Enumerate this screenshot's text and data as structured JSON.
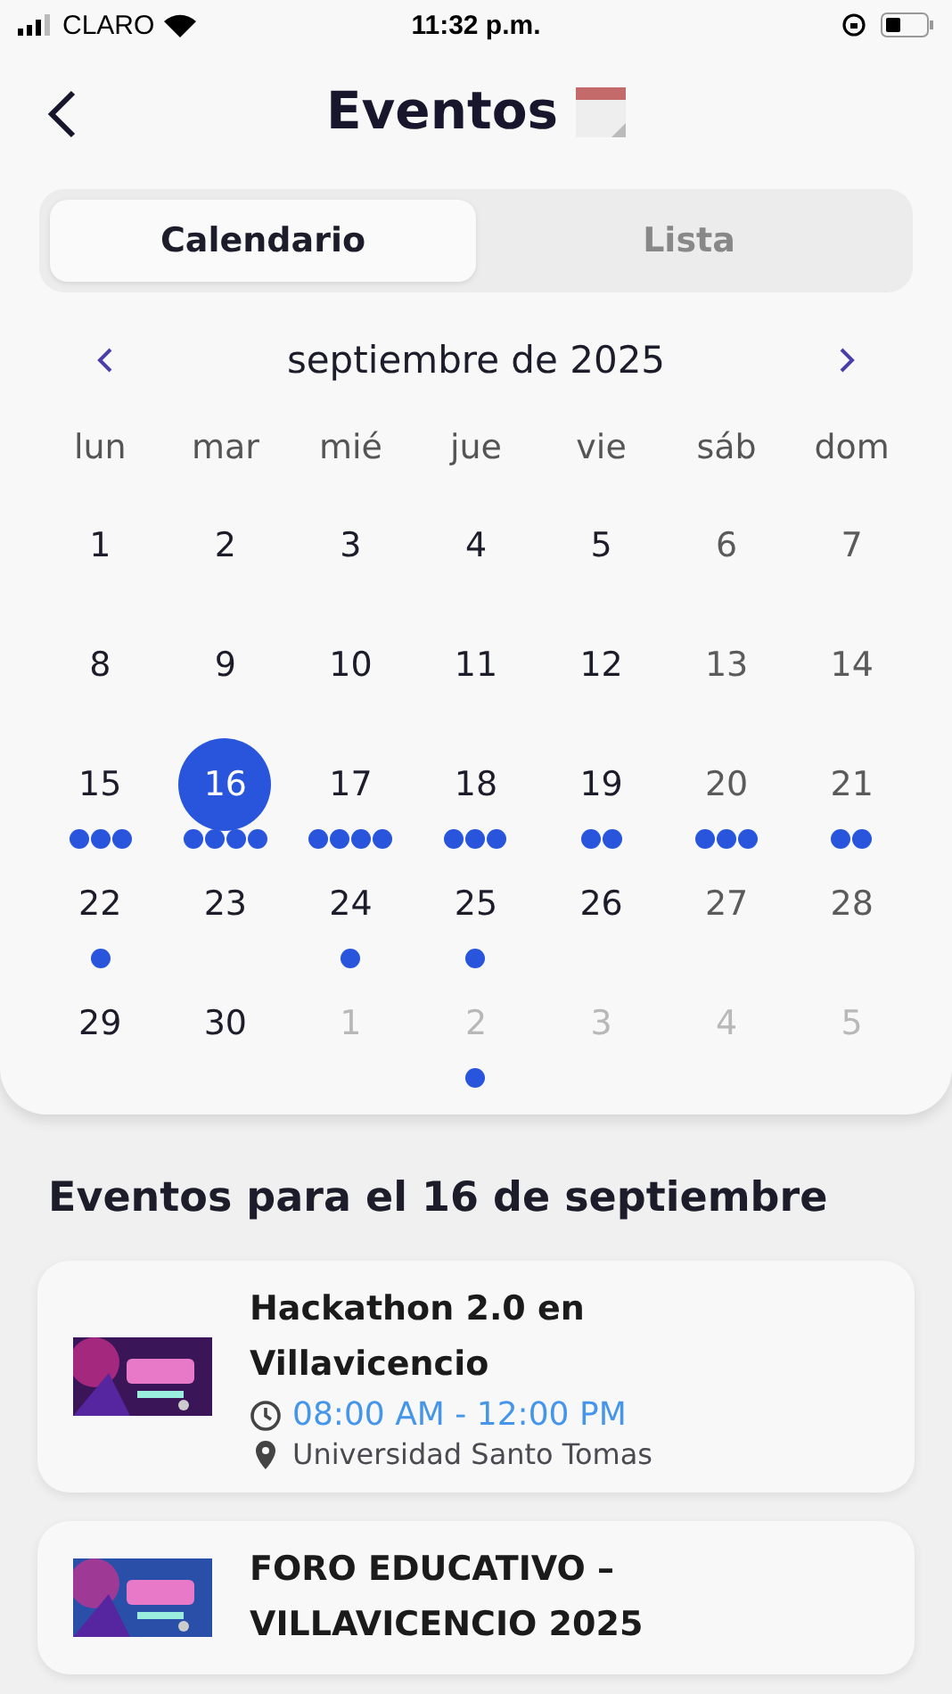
{
  "status_bar": {
    "carrier": "CLARO",
    "time": "11:32 p.m."
  },
  "header": {
    "title": "Eventos"
  },
  "tabs": [
    {
      "label": "Calendario",
      "selected": true
    },
    {
      "label": "Lista",
      "selected": false
    }
  ],
  "calendar": {
    "month": "septiembre de 2025",
    "weekdays": [
      "lun",
      "mar",
      "mié",
      "jue",
      "vie",
      "sáb",
      "dom"
    ],
    "days": [
      {
        "label": "1",
        "kind": "weekday",
        "selected": false
      },
      {
        "label": "2",
        "kind": "weekday",
        "selected": false
      },
      {
        "label": "3",
        "kind": "weekday",
        "selected": false
      },
      {
        "label": "4",
        "kind": "weekday",
        "selected": false
      },
      {
        "label": "5",
        "kind": "weekday",
        "selected": false
      },
      {
        "label": "6",
        "kind": "weekend",
        "selected": false
      },
      {
        "label": "7",
        "kind": "weekend",
        "selected": false
      },
      {
        "label": "8",
        "kind": "weekday",
        "selected": false
      },
      {
        "label": "9",
        "kind": "weekday",
        "selected": false
      },
      {
        "label": "10",
        "kind": "weekday",
        "selected": false
      },
      {
        "label": "11",
        "kind": "weekday",
        "selected": false
      },
      {
        "label": "12",
        "kind": "weekday",
        "selected": false
      },
      {
        "label": "13",
        "kind": "weekend",
        "selected": false
      },
      {
        "label": "14",
        "kind": "weekend",
        "selected": false
      },
      {
        "label": "15",
        "kind": "weekday",
        "dots": [
          true,
          true,
          true
        ],
        "selected": false
      },
      {
        "label": "16",
        "kind": "weekday",
        "dots": [
          true,
          true,
          true,
          true
        ],
        "selected": true
      },
      {
        "label": "17",
        "kind": "weekday",
        "dots": [
          true,
          true,
          true,
          true
        ],
        "selected": false
      },
      {
        "label": "18",
        "kind": "weekday",
        "dots": [
          true,
          true,
          true
        ],
        "selected": false
      },
      {
        "label": "19",
        "kind": "weekday",
        "dots": [
          true,
          true
        ],
        "selected": false
      },
      {
        "label": "20",
        "kind": "weekend",
        "dots": [
          true,
          true,
          true
        ],
        "selected": false
      },
      {
        "label": "21",
        "kind": "weekend",
        "dots": [
          true,
          true
        ],
        "selected": false
      },
      {
        "label": "22",
        "kind": "weekday",
        "dots": [
          true
        ],
        "selected": false
      },
      {
        "label": "23",
        "kind": "weekday",
        "selected": false
      },
      {
        "label": "24",
        "kind": "weekday",
        "dots": [
          true
        ],
        "selected": false
      },
      {
        "label": "25",
        "kind": "weekday",
        "dots": [
          true
        ],
        "selected": false
      },
      {
        "label": "26",
        "kind": "weekday",
        "selected": false
      },
      {
        "label": "27",
        "kind": "weekend",
        "selected": false
      },
      {
        "label": "28",
        "kind": "weekend",
        "selected": false
      },
      {
        "label": "29",
        "kind": "weekday",
        "selected": false
      },
      {
        "label": "30",
        "kind": "weekday",
        "selected": false
      },
      {
        "label": "1",
        "kind": "outside",
        "selected": false
      },
      {
        "label": "2",
        "kind": "outside",
        "dots": [
          true
        ],
        "selected": false
      },
      {
        "label": "3",
        "kind": "outside",
        "selected": false
      },
      {
        "label": "4",
        "kind": "outside",
        "selected": false
      },
      {
        "label": "5",
        "kind": "outside",
        "selected": false
      }
    ]
  },
  "section_title": "Eventos para el 16 de septiembre",
  "events": [
    {
      "title": "Hackathon 2.0 en Villavicencio",
      "time": "08:00 AM - 12:00 PM",
      "place": "Universidad Santo Tomas"
    },
    {
      "title": "FORO EDUCATIVO – VILLAVICENCIO 2025"
    }
  ]
}
